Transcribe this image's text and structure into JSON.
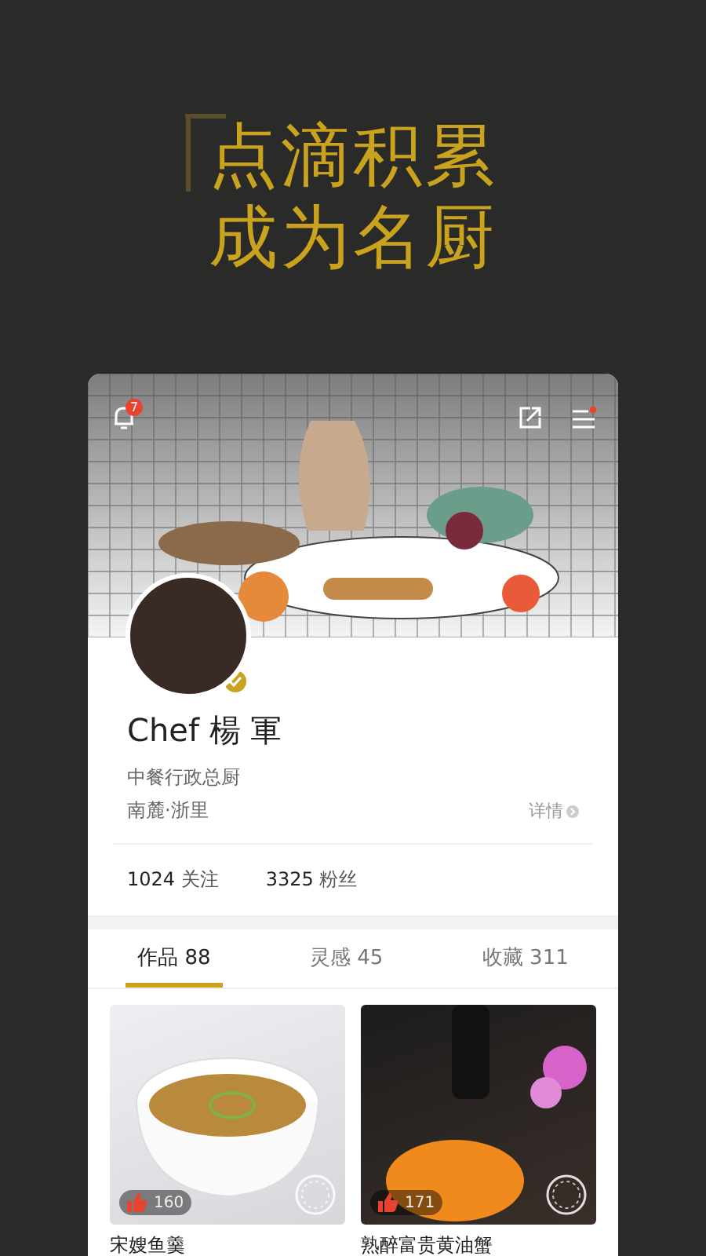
{
  "headline": {
    "lines": [
      "点滴积累",
      "成为名厨"
    ]
  },
  "profile": {
    "notification_count": "7",
    "name": "Chef 楊 軍",
    "title": "中餐行政总厨",
    "location": "南麓·浙里",
    "details_link": "详情",
    "verified": true,
    "stats": [
      {
        "value": "1024",
        "label": "关注"
      },
      {
        "value": "3325",
        "label": "粉丝"
      }
    ]
  },
  "tabs": [
    {
      "label": "作品 88",
      "selected": true
    },
    {
      "label": "灵感 45",
      "selected": false
    },
    {
      "label": "收藏 311",
      "selected": false
    }
  ],
  "works": [
    {
      "title": "宋嫂鱼羹",
      "likes": "160",
      "kind": "soup"
    },
    {
      "title": "熟醉富贵黄油蟹",
      "likes": "171",
      "kind": "crab"
    }
  ]
}
